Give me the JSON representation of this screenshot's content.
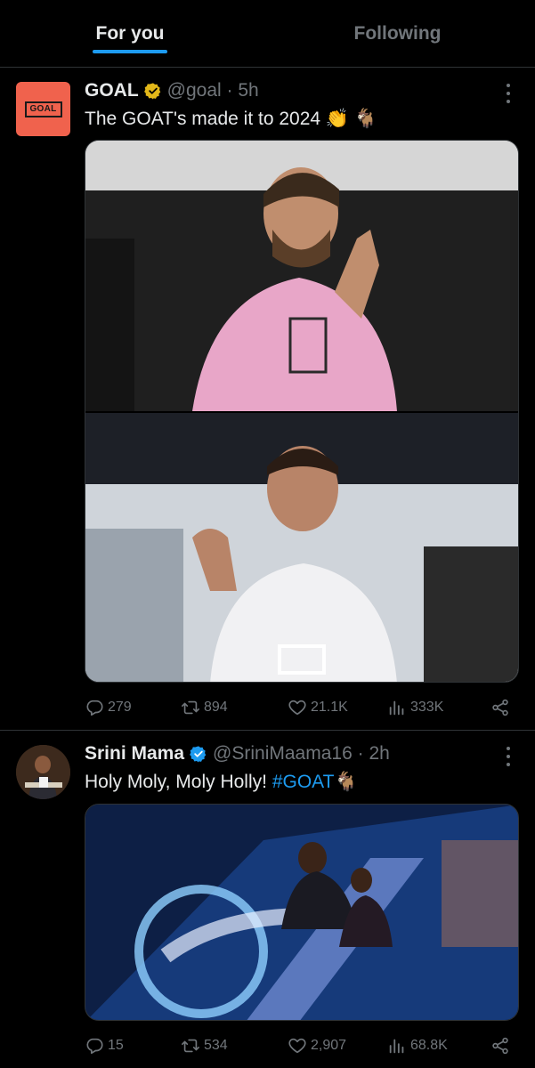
{
  "tabs": {
    "for_you": "For you",
    "following": "Following"
  },
  "tweets": [
    {
      "avatar_text": "GOAL",
      "name": "GOAL",
      "handle": "@goal",
      "time": "5h",
      "text": "The GOAT's made it to 2024",
      "emoji": "👏 🐐",
      "media_count": 2,
      "replies": "279",
      "retweets": "894",
      "likes": "21.1K",
      "views": "333K",
      "verified_color": "#e2b719"
    },
    {
      "name": "Srini Mama",
      "handle": "@SriniMaama16",
      "time": "2h",
      "text": "Holy Moly, Moly Holly!",
      "hashtag": "#GOAT",
      "hashtag_emoji": "🐐",
      "media_count": 1,
      "replies": "15",
      "retweets": "534",
      "likes": "2,907",
      "views": "68.8K",
      "verified_color": "#1d9bf0"
    }
  ],
  "icons": {
    "reply": "reply-icon",
    "retweet": "retweet-icon",
    "like": "like-icon",
    "views": "views-icon",
    "share": "share-icon",
    "more": "more-icon",
    "verified": "verified-badge-icon"
  },
  "colors": {
    "accent": "#1d9bf0",
    "background": "#000000",
    "secondary_text": "#71767b",
    "goal_brand": "#f0624d"
  }
}
